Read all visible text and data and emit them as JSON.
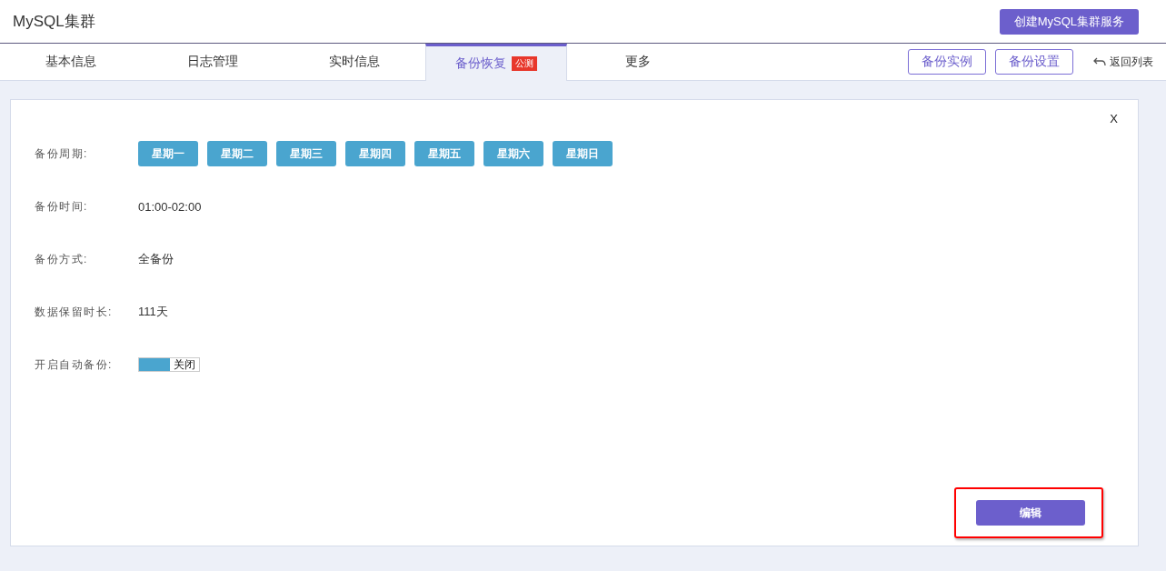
{
  "header": {
    "title": "MySQL集群",
    "create_button": "创建MySQL集群服务"
  },
  "tabs": [
    {
      "label": "基本信息",
      "selected": false
    },
    {
      "label": "日志管理",
      "selected": false
    },
    {
      "label": "实时信息",
      "selected": false
    },
    {
      "label": "备份恢复",
      "selected": true,
      "badge": "公测"
    },
    {
      "label": "更多",
      "selected": false
    }
  ],
  "actions": {
    "buttons": [
      "备份实例",
      "备份设置"
    ],
    "back_link": "返回列表"
  },
  "panel": {
    "close": "X",
    "period": {
      "label": "备份周期:",
      "days": [
        {
          "label": "星期一",
          "selected": true
        },
        {
          "label": "星期二",
          "selected": true
        },
        {
          "label": "星期三",
          "selected": true
        },
        {
          "label": "星期四",
          "selected": true
        },
        {
          "label": "星期五",
          "selected": true
        },
        {
          "label": "星期六",
          "selected": true
        },
        {
          "label": "星期日",
          "selected": true
        }
      ]
    },
    "fields": [
      {
        "label": "备份时间:",
        "value": "01:00-02:00"
      },
      {
        "label": "备份方式:",
        "value": "全备份"
      },
      {
        "label": "数据保留时长:",
        "value": "111天"
      }
    ],
    "auto_backup": {
      "label": "开启自动备份:",
      "on": false,
      "text": "关闭"
    },
    "edit_button": "编辑",
    "edit_highlighted": true
  }
}
